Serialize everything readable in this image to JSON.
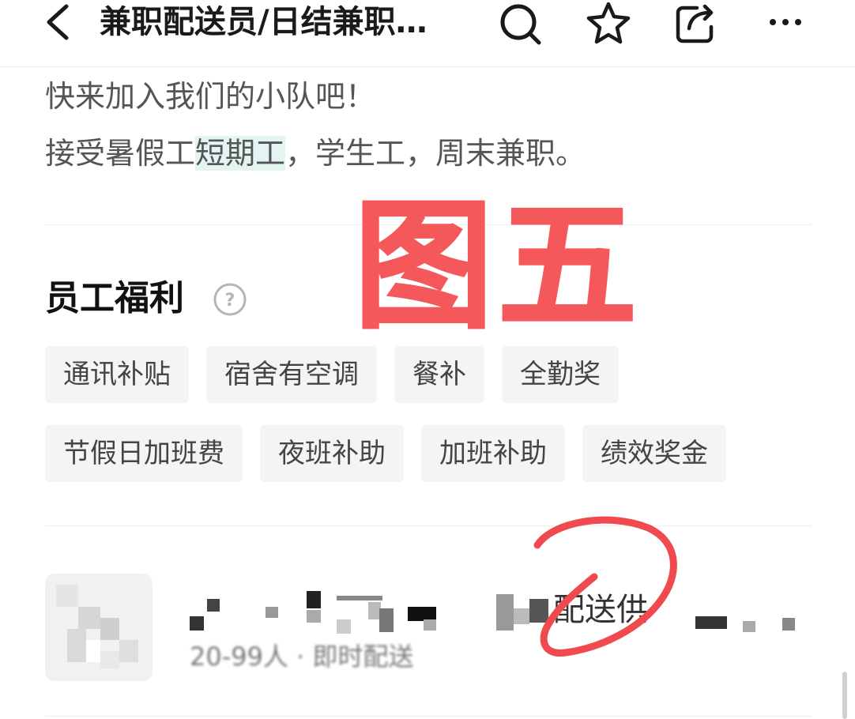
{
  "header": {
    "title": "兼职配送员/日结兼职…",
    "icons": [
      "back-icon",
      "search-icon",
      "star-icon",
      "share-icon",
      "more-icon"
    ]
  },
  "description": {
    "line1": "快来加入我们的小队吧！",
    "line2_before": "接受暑假工",
    "line2_highlight": "短期工",
    "line2_after": "，学生工，周末兼职。"
  },
  "watermark": {
    "text": "图五",
    "color": "#f4585b"
  },
  "benefits": {
    "title": "员工福利",
    "help_icon": "help-circle-icon",
    "rows": [
      [
        "通讯补贴",
        "宿舍有空调",
        "餐补",
        "全勤奖"
      ],
      [
        "节假日加班费",
        "夜班补助",
        "加班补助",
        "绩效奖金"
      ]
    ]
  },
  "company": {
    "name_visible": "配送供",
    "meta": "20-99人 · 即时配送",
    "annotation_text": "2"
  },
  "colors": {
    "tag_bg": "#f4f4f4",
    "highlight_bg": "#e3f4f3",
    "annotation": "#f04a4f"
  }
}
